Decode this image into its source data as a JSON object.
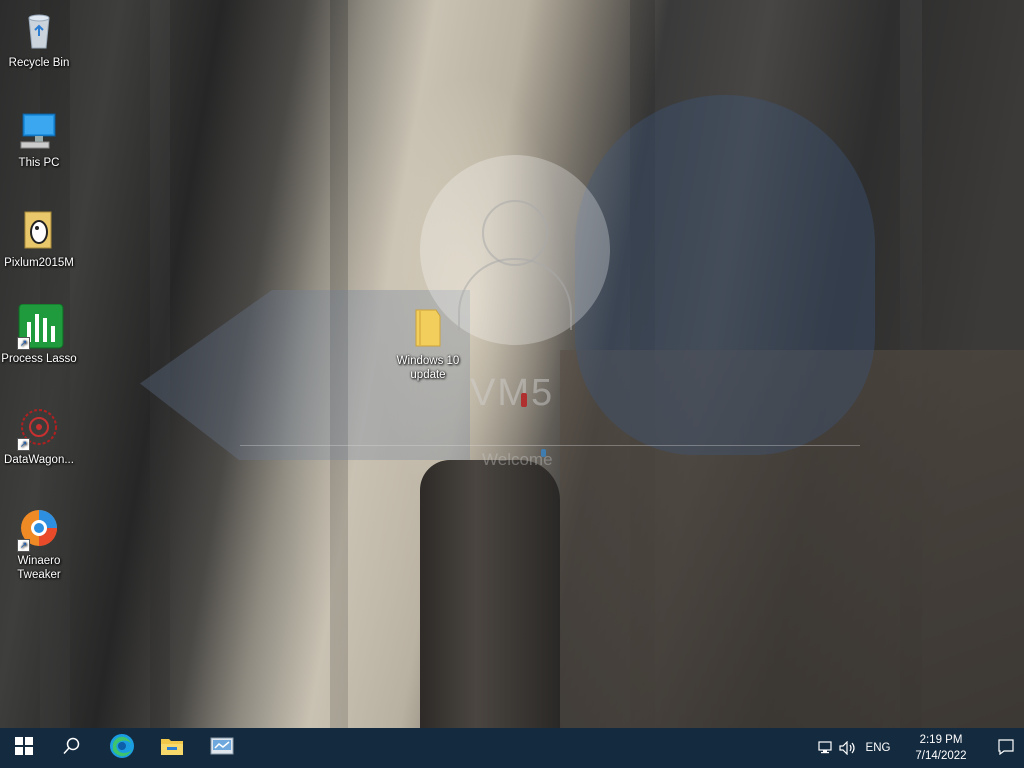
{
  "desktop": {
    "icons": [
      {
        "label": "Recycle Bin"
      },
      {
        "label": "This PC"
      },
      {
        "label": "Pixlum2015M"
      },
      {
        "label": "Process Lasso"
      },
      {
        "label": "DataWagon..."
      },
      {
        "label": "Winaero Tweaker"
      },
      {
        "label": "Windows 10 update"
      }
    ],
    "watermark": {
      "text": "VM5",
      "welcome": "Welcome"
    }
  },
  "taskbar": {
    "start_icon": "windows-logo-icon",
    "search_icon": "search-icon",
    "pinned": [
      {
        "name": "edge-icon"
      },
      {
        "name": "file-explorer-icon"
      },
      {
        "name": "control-panel-icon"
      }
    ],
    "tray": {
      "language": "ENG",
      "time": "2:19 PM",
      "date": "7/14/2022"
    },
    "colors": {
      "taskbar_bg": "#142a3f",
      "accent": "#0078d7"
    }
  }
}
